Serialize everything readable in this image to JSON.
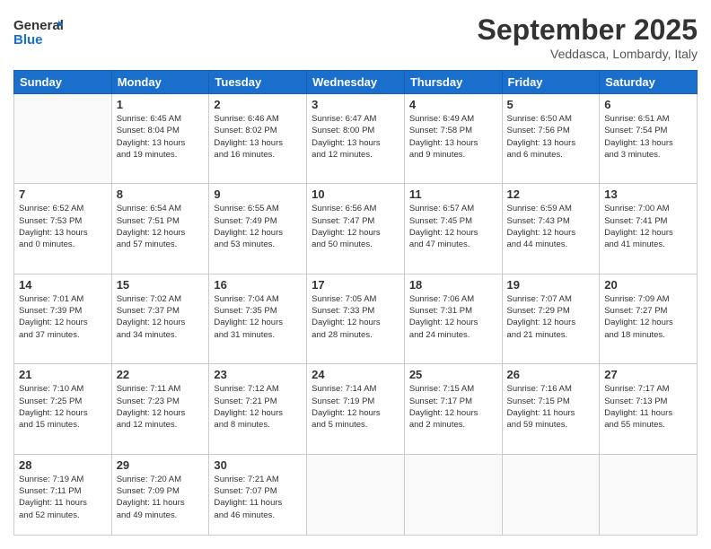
{
  "header": {
    "logo_line1": "General",
    "logo_line2": "Blue",
    "month_title": "September 2025",
    "location": "Veddasca, Lombardy, Italy"
  },
  "days_of_week": [
    "Sunday",
    "Monday",
    "Tuesday",
    "Wednesday",
    "Thursday",
    "Friday",
    "Saturday"
  ],
  "weeks": [
    [
      {
        "day": "",
        "info": ""
      },
      {
        "day": "1",
        "info": "Sunrise: 6:45 AM\nSunset: 8:04 PM\nDaylight: 13 hours\nand 19 minutes."
      },
      {
        "day": "2",
        "info": "Sunrise: 6:46 AM\nSunset: 8:02 PM\nDaylight: 13 hours\nand 16 minutes."
      },
      {
        "day": "3",
        "info": "Sunrise: 6:47 AM\nSunset: 8:00 PM\nDaylight: 13 hours\nand 12 minutes."
      },
      {
        "day": "4",
        "info": "Sunrise: 6:49 AM\nSunset: 7:58 PM\nDaylight: 13 hours\nand 9 minutes."
      },
      {
        "day": "5",
        "info": "Sunrise: 6:50 AM\nSunset: 7:56 PM\nDaylight: 13 hours\nand 6 minutes."
      },
      {
        "day": "6",
        "info": "Sunrise: 6:51 AM\nSunset: 7:54 PM\nDaylight: 13 hours\nand 3 minutes."
      }
    ],
    [
      {
        "day": "7",
        "info": "Sunrise: 6:52 AM\nSunset: 7:53 PM\nDaylight: 13 hours\nand 0 minutes."
      },
      {
        "day": "8",
        "info": "Sunrise: 6:54 AM\nSunset: 7:51 PM\nDaylight: 12 hours\nand 57 minutes."
      },
      {
        "day": "9",
        "info": "Sunrise: 6:55 AM\nSunset: 7:49 PM\nDaylight: 12 hours\nand 53 minutes."
      },
      {
        "day": "10",
        "info": "Sunrise: 6:56 AM\nSunset: 7:47 PM\nDaylight: 12 hours\nand 50 minutes."
      },
      {
        "day": "11",
        "info": "Sunrise: 6:57 AM\nSunset: 7:45 PM\nDaylight: 12 hours\nand 47 minutes."
      },
      {
        "day": "12",
        "info": "Sunrise: 6:59 AM\nSunset: 7:43 PM\nDaylight: 12 hours\nand 44 minutes."
      },
      {
        "day": "13",
        "info": "Sunrise: 7:00 AM\nSunset: 7:41 PM\nDaylight: 12 hours\nand 41 minutes."
      }
    ],
    [
      {
        "day": "14",
        "info": "Sunrise: 7:01 AM\nSunset: 7:39 PM\nDaylight: 12 hours\nand 37 minutes."
      },
      {
        "day": "15",
        "info": "Sunrise: 7:02 AM\nSunset: 7:37 PM\nDaylight: 12 hours\nand 34 minutes."
      },
      {
        "day": "16",
        "info": "Sunrise: 7:04 AM\nSunset: 7:35 PM\nDaylight: 12 hours\nand 31 minutes."
      },
      {
        "day": "17",
        "info": "Sunrise: 7:05 AM\nSunset: 7:33 PM\nDaylight: 12 hours\nand 28 minutes."
      },
      {
        "day": "18",
        "info": "Sunrise: 7:06 AM\nSunset: 7:31 PM\nDaylight: 12 hours\nand 24 minutes."
      },
      {
        "day": "19",
        "info": "Sunrise: 7:07 AM\nSunset: 7:29 PM\nDaylight: 12 hours\nand 21 minutes."
      },
      {
        "day": "20",
        "info": "Sunrise: 7:09 AM\nSunset: 7:27 PM\nDaylight: 12 hours\nand 18 minutes."
      }
    ],
    [
      {
        "day": "21",
        "info": "Sunrise: 7:10 AM\nSunset: 7:25 PM\nDaylight: 12 hours\nand 15 minutes."
      },
      {
        "day": "22",
        "info": "Sunrise: 7:11 AM\nSunset: 7:23 PM\nDaylight: 12 hours\nand 12 minutes."
      },
      {
        "day": "23",
        "info": "Sunrise: 7:12 AM\nSunset: 7:21 PM\nDaylight: 12 hours\nand 8 minutes."
      },
      {
        "day": "24",
        "info": "Sunrise: 7:14 AM\nSunset: 7:19 PM\nDaylight: 12 hours\nand 5 minutes."
      },
      {
        "day": "25",
        "info": "Sunrise: 7:15 AM\nSunset: 7:17 PM\nDaylight: 12 hours\nand 2 minutes."
      },
      {
        "day": "26",
        "info": "Sunrise: 7:16 AM\nSunset: 7:15 PM\nDaylight: 11 hours\nand 59 minutes."
      },
      {
        "day": "27",
        "info": "Sunrise: 7:17 AM\nSunset: 7:13 PM\nDaylight: 11 hours\nand 55 minutes."
      }
    ],
    [
      {
        "day": "28",
        "info": "Sunrise: 7:19 AM\nSunset: 7:11 PM\nDaylight: 11 hours\nand 52 minutes."
      },
      {
        "day": "29",
        "info": "Sunrise: 7:20 AM\nSunset: 7:09 PM\nDaylight: 11 hours\nand 49 minutes."
      },
      {
        "day": "30",
        "info": "Sunrise: 7:21 AM\nSunset: 7:07 PM\nDaylight: 11 hours\nand 46 minutes."
      },
      {
        "day": "",
        "info": ""
      },
      {
        "day": "",
        "info": ""
      },
      {
        "day": "",
        "info": ""
      },
      {
        "day": "",
        "info": ""
      }
    ]
  ]
}
